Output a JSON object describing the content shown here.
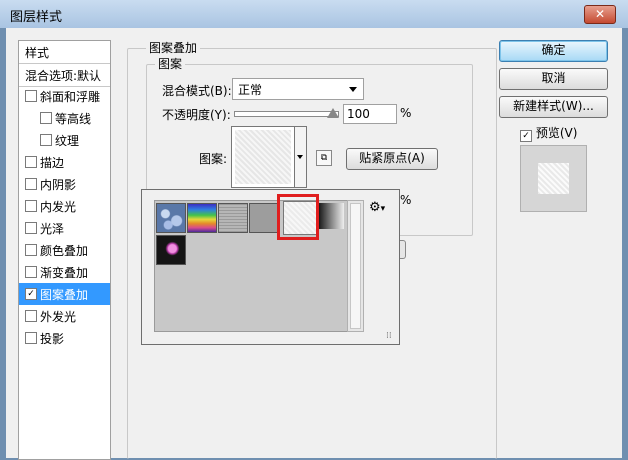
{
  "window": {
    "title": "图层样式",
    "close_label": "✕"
  },
  "styles_panel": {
    "header": "样式",
    "blend_options": "混合选项:默认",
    "items": [
      {
        "label": "斜面和浮雕",
        "checked": false,
        "indent": false,
        "selected": false
      },
      {
        "label": "等高线",
        "checked": false,
        "indent": true,
        "selected": false
      },
      {
        "label": "纹理",
        "checked": false,
        "indent": true,
        "selected": false
      },
      {
        "label": "描边",
        "checked": false,
        "indent": false,
        "selected": false
      },
      {
        "label": "内阴影",
        "checked": false,
        "indent": false,
        "selected": false
      },
      {
        "label": "内发光",
        "checked": false,
        "indent": false,
        "selected": false
      },
      {
        "label": "光泽",
        "checked": false,
        "indent": false,
        "selected": false
      },
      {
        "label": "颜色叠加",
        "checked": false,
        "indent": false,
        "selected": false
      },
      {
        "label": "渐变叠加",
        "checked": false,
        "indent": false,
        "selected": false
      },
      {
        "label": "图案叠加",
        "checked": true,
        "indent": false,
        "selected": true
      },
      {
        "label": "外发光",
        "checked": false,
        "indent": false,
        "selected": false
      },
      {
        "label": "投影",
        "checked": false,
        "indent": false,
        "selected": false
      }
    ]
  },
  "pattern_overlay": {
    "group_title": "图案叠加",
    "sub_group_title": "图案",
    "blend_mode_label": "混合模式(B):",
    "blend_mode_value": "正常",
    "opacity_label": "不透明度(Y):",
    "opacity_value": "100",
    "opacity_unit": "%",
    "opacity_fraction": 1.0,
    "pattern_label": "图案:",
    "snap_origin_button": "贴紧原点(A)",
    "scale_unit": "%"
  },
  "pattern_picker": {
    "gear_icon": "⚙",
    "gear_caret": "▾",
    "swatches": [
      "bubbles",
      "rainbow",
      "gray-texture",
      "mid-gray",
      "white-texture",
      "dark-gradient",
      "flower"
    ],
    "selected_swatch": "white-texture"
  },
  "buttons": {
    "ok": "确定",
    "cancel": "取消",
    "new_style": "新建样式(W)..."
  },
  "preview": {
    "label": "预览(V)",
    "checked": true
  },
  "colors": {
    "selection": "#3399ff",
    "highlight_box": "#e01e1e"
  }
}
